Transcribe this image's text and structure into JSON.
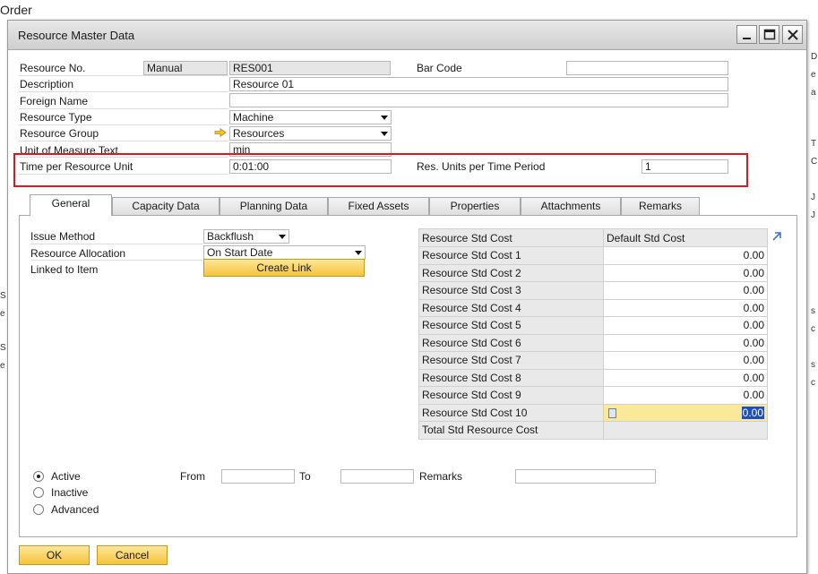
{
  "background": {
    "title": "Order",
    "right_glyphs": [
      "D",
      "e",
      "a",
      "T",
      "C",
      "J",
      "J",
      "s",
      "c",
      "s",
      "c"
    ],
    "left_glyphs": [
      "S",
      "e",
      "S",
      "e"
    ]
  },
  "window": {
    "title": "Resource Master Data"
  },
  "header": {
    "resource_no_label": "Resource No.",
    "resource_no_series": "Manual",
    "resource_no_value": "RES001",
    "bar_code_label": "Bar Code",
    "bar_code_value": "",
    "description_label": "Description",
    "description_value": "Resource 01",
    "foreign_name_label": "Foreign Name",
    "foreign_name_value": "",
    "resource_type_label": "Resource Type",
    "resource_type_value": "Machine",
    "resource_group_label": "Resource Group",
    "resource_group_value": "Resources",
    "uom_text_label": "Unit of Measure Text",
    "uom_text_value": "min",
    "time_per_unit_label": "Time per Resource Unit",
    "time_per_unit_value": "0:01:00",
    "res_units_label": "Res. Units per Time Period",
    "res_units_value": "1"
  },
  "tabs": [
    {
      "label": "General",
      "active": true
    },
    {
      "label": "Capacity Data",
      "active": false
    },
    {
      "label": "Planning Data",
      "active": false
    },
    {
      "label": "Fixed Assets",
      "active": false
    },
    {
      "label": "Properties",
      "active": false
    },
    {
      "label": "Attachments",
      "active": false
    },
    {
      "label": "Remarks",
      "active": false
    }
  ],
  "general": {
    "issue_method_label": "Issue Method",
    "issue_method_value": "Backflush",
    "resource_allocation_label": "Resource Allocation",
    "resource_allocation_value": "On Start Date",
    "linked_to_item_label": "Linked to Item",
    "create_link_label": "Create Link",
    "cost_table": {
      "col1_header": "Resource Std Cost",
      "col2_header": "Default Std Cost",
      "rows": [
        {
          "label": "Resource Std Cost 1",
          "value": "0.00"
        },
        {
          "label": "Resource Std Cost 2",
          "value": "0.00"
        },
        {
          "label": "Resource Std Cost 3",
          "value": "0.00"
        },
        {
          "label": "Resource Std Cost 4",
          "value": "0.00"
        },
        {
          "label": "Resource Std Cost 5",
          "value": "0.00"
        },
        {
          "label": "Resource Std Cost 6",
          "value": "0.00"
        },
        {
          "label": "Resource Std Cost 7",
          "value": "0.00"
        },
        {
          "label": "Resource Std Cost 8",
          "value": "0.00"
        },
        {
          "label": "Resource Std Cost 9",
          "value": "0.00"
        },
        {
          "label": "Resource Std Cost 10",
          "value": "0.00"
        }
      ],
      "total_label": "Total Std Resource Cost",
      "total_value": ""
    },
    "status": {
      "active_label": "Active",
      "inactive_label": "Inactive",
      "advanced_label": "Advanced",
      "selected": "Active"
    },
    "from_label": "From",
    "to_label": "To",
    "remarks_label": "Remarks"
  },
  "footer": {
    "ok_label": "OK",
    "cancel_label": "Cancel"
  },
  "colors": {
    "highlight_border": "#e0161f",
    "button_gold": "#f5c43a",
    "selected_cell": "#fbe99a"
  }
}
